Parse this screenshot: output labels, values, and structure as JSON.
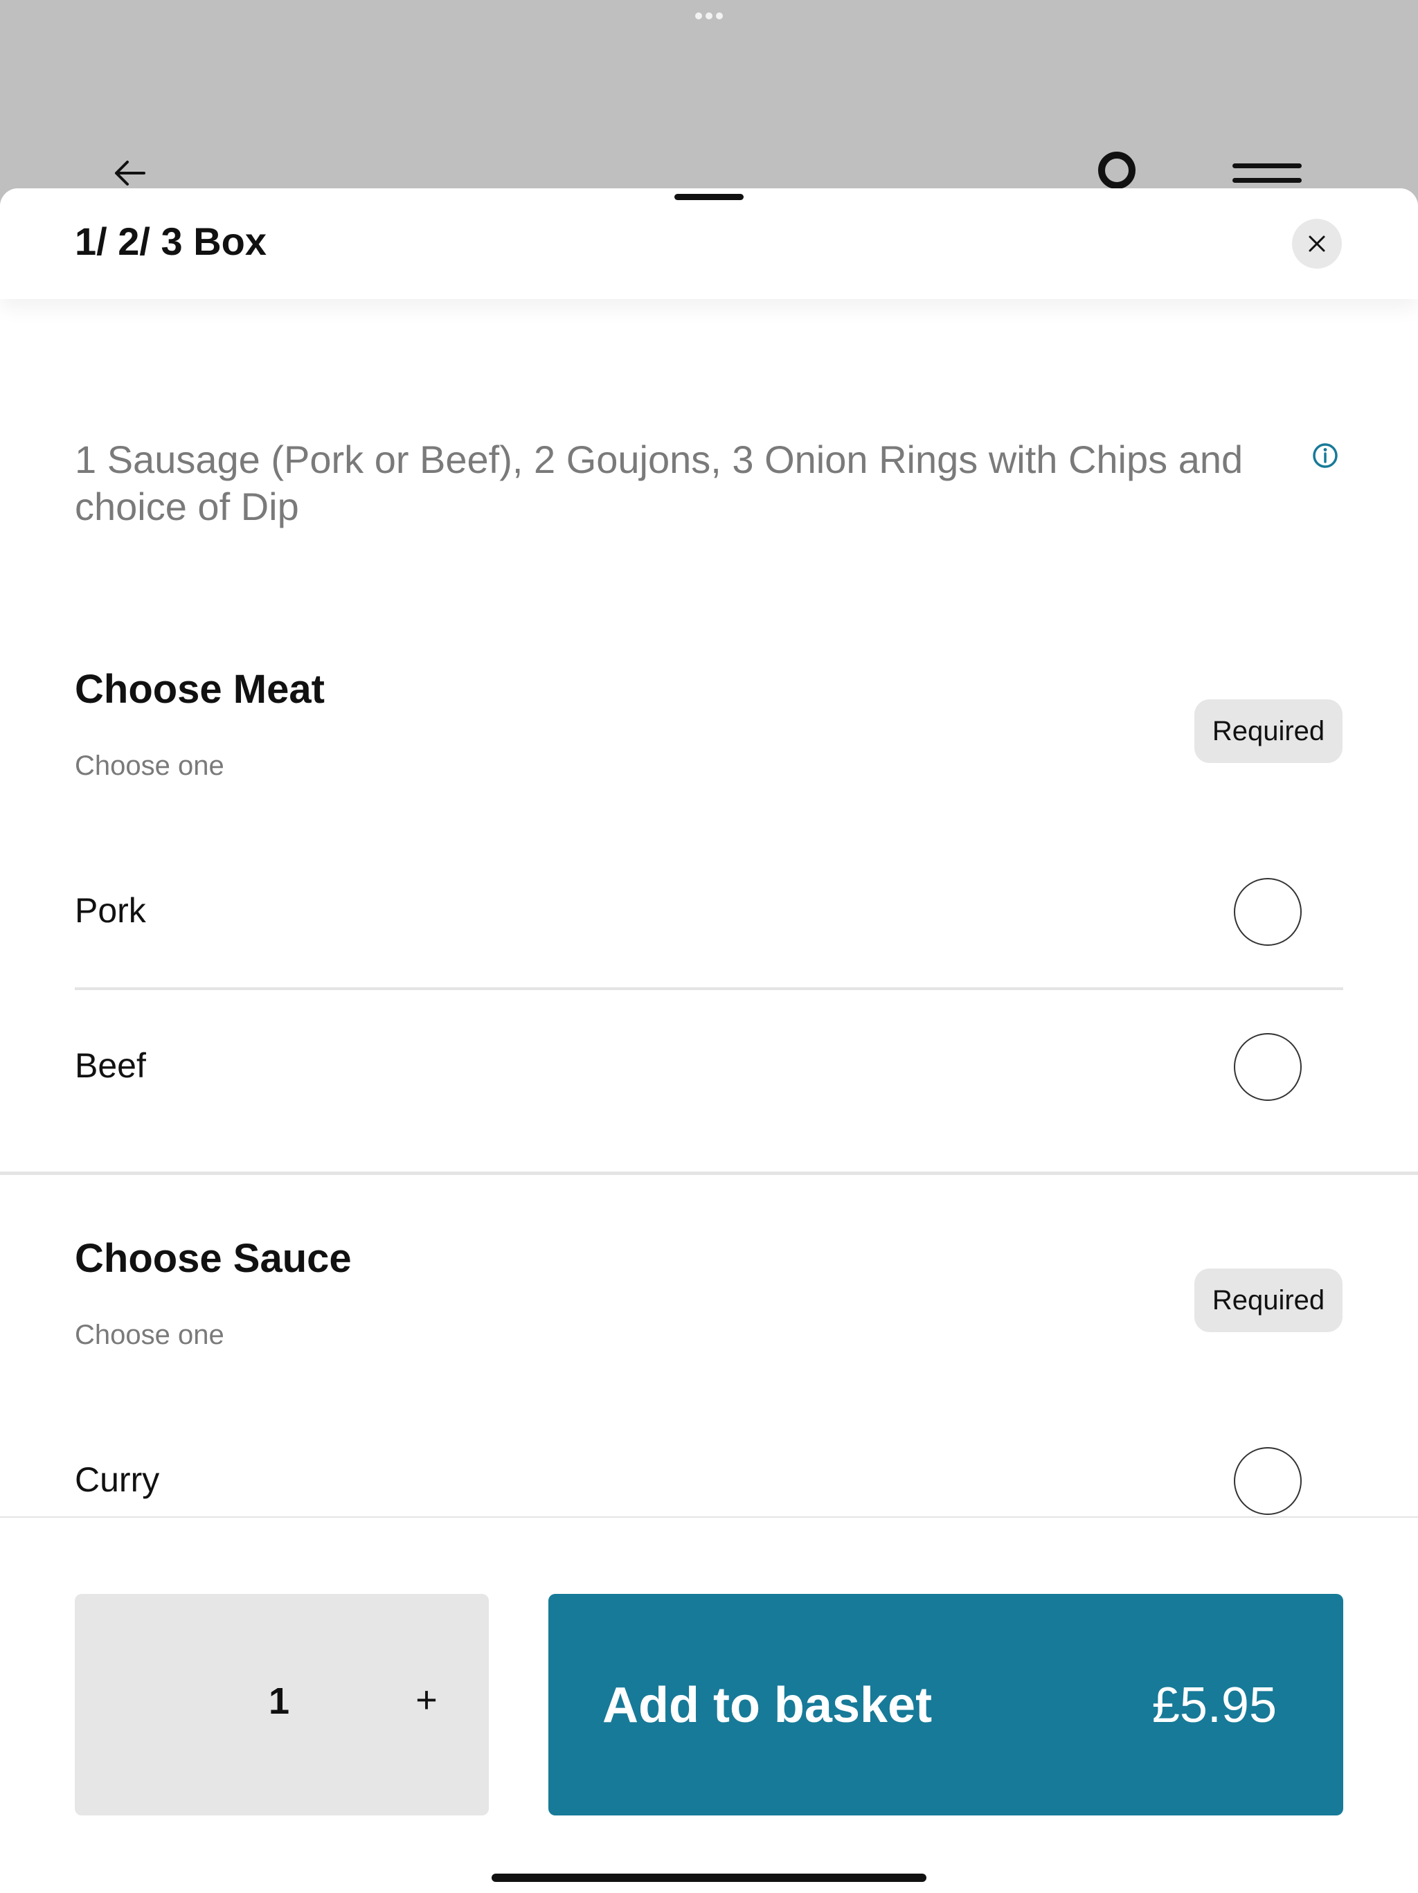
{
  "background_page": {
    "back_icon": "arrow-left-icon",
    "profile_icon": "circle-icon",
    "menu_icon": "hamburger-menu-icon"
  },
  "sheet": {
    "title": "1/ 2/ 3 Box",
    "close_icon": "close-icon",
    "description": "1 Sausage (Pork or Beef), 2 Goujons, 3 Onion Rings with Chips and choice of Dip",
    "info_icon": "info-icon",
    "groups": [
      {
        "title": "Choose Meat",
        "subtitle": "Choose one",
        "badge": "Required",
        "options": [
          {
            "label": "Pork"
          },
          {
            "label": "Beef"
          }
        ]
      },
      {
        "title": "Choose Sauce",
        "subtitle": "Choose one",
        "badge": "Required",
        "options": [
          {
            "label": "Curry"
          }
        ]
      }
    ]
  },
  "footer": {
    "quantity": "1",
    "plus_label": "+",
    "add_label": "Add to basket",
    "price": "£5.95",
    "accent_color": "#177a98"
  }
}
